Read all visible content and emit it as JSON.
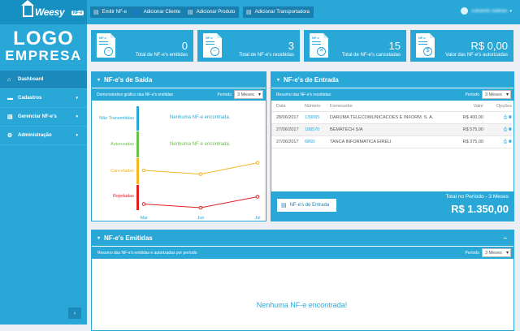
{
  "brand": {
    "name": "Weesy",
    "pill": "NF-e"
  },
  "toolbar": [
    {
      "label": "Emitir NF-e",
      "icon": "document-icon"
    },
    {
      "label": "Adicionar Cliente",
      "icon": "user-icon"
    },
    {
      "label": "Adicionar Produto",
      "icon": "document-icon"
    },
    {
      "label": "Adicionar Transportadora",
      "icon": "document-icon"
    }
  ],
  "user": {
    "name": "Eduardo Salinas"
  },
  "logo": {
    "line1": "LOGO",
    "line2": "EMPRESA"
  },
  "sidebar": {
    "items": [
      {
        "label": "Dashboard",
        "icon": "home-icon"
      },
      {
        "label": "Cadastros",
        "icon": "folder-icon"
      },
      {
        "label": "Gerenciar NF-e's",
        "icon": "document-icon"
      },
      {
        "label": "Administração",
        "icon": "gear-icon"
      }
    ],
    "collapse": "‹"
  },
  "cards": [
    {
      "value": "0",
      "label": "Total de NF-e's emitidas",
      "doc": "NF-e",
      "symbol": "→"
    },
    {
      "value": "3",
      "label": "Total de NF-e's recebidas",
      "doc": "NF-e",
      "symbol": "←"
    },
    {
      "value": "15",
      "label": "Total de NF-e's canceladas",
      "doc": "NF-e",
      "symbol": "✕"
    },
    {
      "value": "R$ 0,00",
      "label": "Valor das NF-e's autorizadas",
      "doc": "NF-e",
      "symbol": "$"
    }
  ],
  "saida": {
    "title": "NF-e's de Saída",
    "subtitle": "Demonstrativo gráfico das NF-e's emitidas",
    "period_label": "Período",
    "period_value": "3 Meses",
    "empty_text": "Nenhuma NF-e encontrada.",
    "chart_data": {
      "type": "line",
      "categories": [
        "Mai",
        "Jun",
        "Jul"
      ],
      "row_labels": [
        "Não Transmitidas",
        "Autorizadas",
        "Canceladas",
        "Rejeitadas"
      ],
      "series": [
        {
          "name": "Canceladas",
          "values": [
            3,
            2,
            5
          ],
          "color": "#f5b622"
        },
        {
          "name": "Rejeitadas",
          "values": [
            1,
            0,
            3
          ],
          "color": "#e02020"
        }
      ],
      "colors": {
        "nao_transmitidas": "#29a8d8",
        "autorizadas": "#6cc04a",
        "canceladas": "#f5b622",
        "rejeitadas": "#e02020"
      }
    }
  },
  "entrada": {
    "title": "NF-e's de Entrada",
    "subtitle": "Resumo das NF-e's recebidas",
    "period_label": "Período",
    "period_value": "3 Meses",
    "columns": [
      "Data",
      "Número",
      "Fornecedor",
      "Valor",
      "Opções"
    ],
    "rows": [
      {
        "data": "28/06/2017",
        "numero": "139065",
        "fornecedor": "DARUMA TELECOMUNICACOES E INFORM. S. A.",
        "valor": "R$ 400,00"
      },
      {
        "data": "27/06/2017",
        "numero": "188570",
        "fornecedor": "BEMATECH S/A",
        "valor": "R$ 575,00"
      },
      {
        "data": "27/06/2017",
        "numero": "6860",
        "fornecedor": "TANCA INFORMATICA EIRELI",
        "valor": "R$ 375,00"
      }
    ],
    "button": "NF-e's de Entrada",
    "total_label": "Total no Período - 3 Meses",
    "total_value": "R$ 1.350,00"
  },
  "emitidas": {
    "title": "NF-e's Emitidas",
    "subtitle": "Resumo das NF-e's emitidas e autorizadas por período",
    "period_label": "Período",
    "period_value": "3 Meses",
    "empty_text": "Nenhuma NF-e encontrada!"
  }
}
